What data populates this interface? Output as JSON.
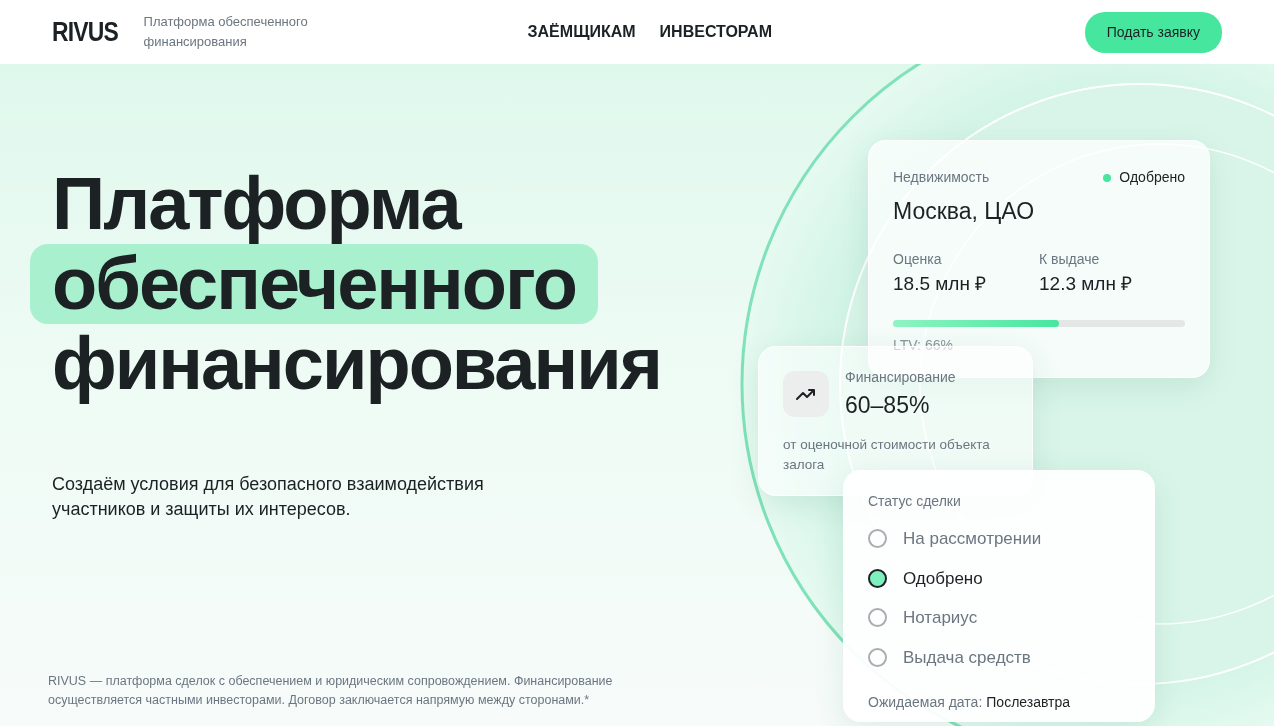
{
  "header": {
    "logo": "RIVUS",
    "tagline": "Платформа обеспеченного финансирования",
    "nav": [
      "ЗАЁМЩИКАМ",
      "ИНВЕСТОРАМ"
    ],
    "cta": "Подать заявку"
  },
  "hero": {
    "title_lines": [
      {
        "text": "Платформа",
        "highlighted": false
      },
      {
        "text": "обеспеченного",
        "highlighted": true
      },
      {
        "text": "финансирования",
        "highlighted": false
      }
    ],
    "subtitle": "Создаём условия для безопасного взаимодействия участников и защиты их интересов.",
    "footnote": "RIVUS — платформа сделок с обеспечением и юридическим сопровождением. Финансирование осуществляется частными инвесторами. Договор заключается напрямую между сторонами.*"
  },
  "property_card": {
    "category": "Недвижимость",
    "status": "Одобрено",
    "location": "Москва, ЦАО",
    "stats": [
      {
        "label": "Оценка",
        "value": "18.5 млн ₽"
      },
      {
        "label": "К выдаче",
        "value": "12.3 млн ₽"
      }
    ],
    "ltv": {
      "level": 0.57,
      "label": "LTV: 66%"
    }
  },
  "financing_card": {
    "title": "Финансирование",
    "value": "60–85%",
    "note": "от оценочной стоимости объекта залога"
  },
  "status_card": {
    "title": "Статус сделки",
    "steps": [
      {
        "label": "На рассмотрении",
        "selected": false
      },
      {
        "label": "Одобрено",
        "selected": true
      },
      {
        "label": "Нотариус",
        "selected": false
      },
      {
        "label": "Выдача средств",
        "selected": false
      }
    ],
    "date_label": "Ожидаемая дата:",
    "date_value": "Послезавтра"
  }
}
